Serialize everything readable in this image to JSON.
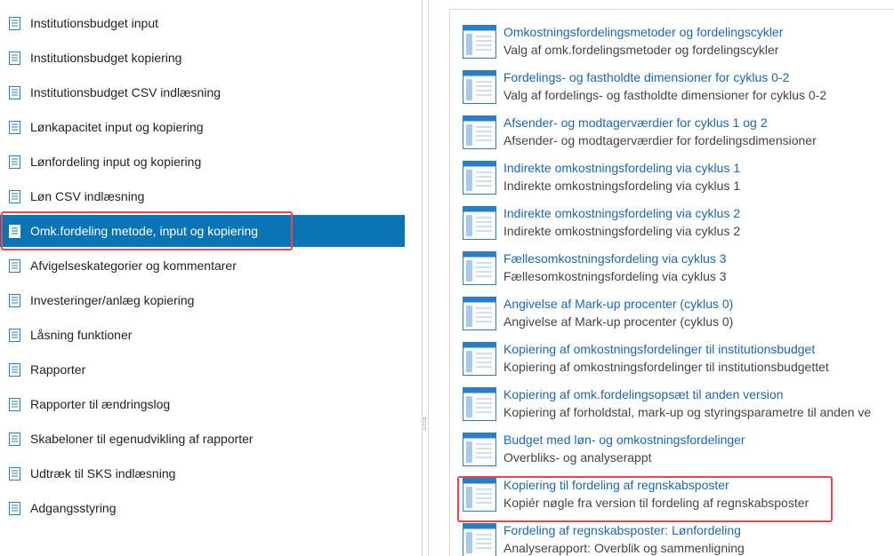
{
  "nav": {
    "items": [
      {
        "label": "Institutionsbudget input"
      },
      {
        "label": "Institutionsbudget kopiering"
      },
      {
        "label": "Institutionsbudget CSV indlæsning"
      },
      {
        "label": "Lønkapacitet input og kopiering"
      },
      {
        "label": "Lønfordeling input og kopiering"
      },
      {
        "label": "Løn CSV indlæsning"
      },
      {
        "label": "Omk.fordeling metode, input og kopiering",
        "selected": true
      },
      {
        "label": "Afvigelseskategorier og kommentarer"
      },
      {
        "label": "Investeringer/anlæg kopiering"
      },
      {
        "label": "Låsning funktioner"
      },
      {
        "label": "Rapporter"
      },
      {
        "label": "Rapporter til ændringslog"
      },
      {
        "label": "Skabeloner til egenudvikling af rapporter"
      },
      {
        "label": "Udtræk til SKS indlæsning"
      },
      {
        "label": "Adgangsstyring"
      }
    ]
  },
  "content": {
    "tiles": [
      {
        "title": "Omkostningsfordelingsmetoder og fordelingscykler",
        "subtitle": "Valg af omk.fordelingsmetoder og fordelingscykler"
      },
      {
        "title": "Fordelings- og fastholdte dimensioner for cyklus 0-2",
        "subtitle": "Valg af fordelings- og fastholdte dimensioner for cyklus 0-2"
      },
      {
        "title": "Afsender- og modtagerværdier for cyklus 1 og 2",
        "subtitle": "Afsender- og modtagerværdier for fordelingsdimensioner"
      },
      {
        "title": "Indirekte omkostningsfordeling via cyklus 1",
        "subtitle": "Indirekte omkostningsfordeling via cyklus 1"
      },
      {
        "title": "Indirekte omkostningsfordeling via cyklus 2",
        "subtitle": "Indirekte omkostningsfordeling via cyklus 2"
      },
      {
        "title": "Fællesomkostningsfordeling via cyklus 3",
        "subtitle": "Fællesomkostningsfordeling via cyklus 3"
      },
      {
        "title": "Angivelse af Mark-up procenter (cyklus 0)",
        "subtitle": "Angivelse af Mark-up procenter (cyklus 0)"
      },
      {
        "title": "Kopiering af omkostningsfordelinger til institutionsbudget",
        "subtitle": "Kopiering af omkostningsfordelinger til institutionsbudgettet"
      },
      {
        "title": "Kopiering af omk.fordelingsopsæt til anden version",
        "subtitle": "Kopiering af forholdstal, mark-up og styringsparametre til anden ve"
      },
      {
        "title": "Budget med løn- og omkostningsfordelinger",
        "subtitle": "Overbliks- og analyserappt"
      },
      {
        "title": "Kopiering til fordeling af regnskabsposter",
        "subtitle": "Kopiér nøgle fra version til fordeling af regnskabsposter",
        "highlighted": true
      },
      {
        "title": "Fordeling af regnskabsposter: Lønfordeling",
        "subtitle": "Analyserapport: Overblik og sammenligning"
      }
    ]
  },
  "colors": {
    "selected_bg": "#0a74b5",
    "link_blue": "#1b67b3",
    "highlight_red": "#e8474a",
    "icon_blue": "#2a7fc4"
  }
}
